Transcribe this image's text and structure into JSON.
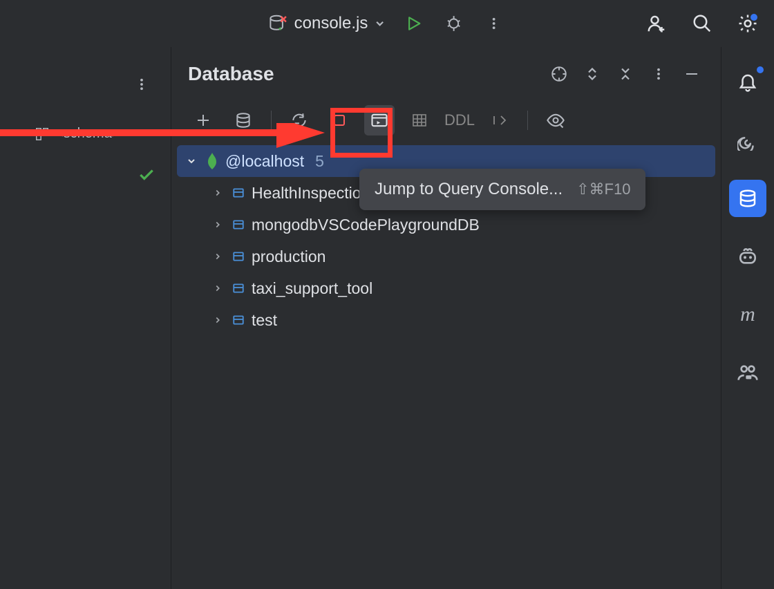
{
  "topBar": {
    "fileName": "console.js"
  },
  "leftSidebar": {
    "schemaLabel": "<schema>"
  },
  "panel": {
    "title": "Database"
  },
  "toolbar": {
    "ddl": "DDL"
  },
  "tree": {
    "root": {
      "label": "@localhost",
      "count": "5"
    },
    "children": [
      {
        "label": "HealthInspections..."
      },
      {
        "label": "mongodbVSCodePlaygroundDB"
      },
      {
        "label": "production"
      },
      {
        "label": "taxi_support_tool"
      },
      {
        "label": "test"
      }
    ]
  },
  "tooltip": {
    "label": "Jump to Query Console...",
    "shortcut": "⇧⌘F10"
  }
}
